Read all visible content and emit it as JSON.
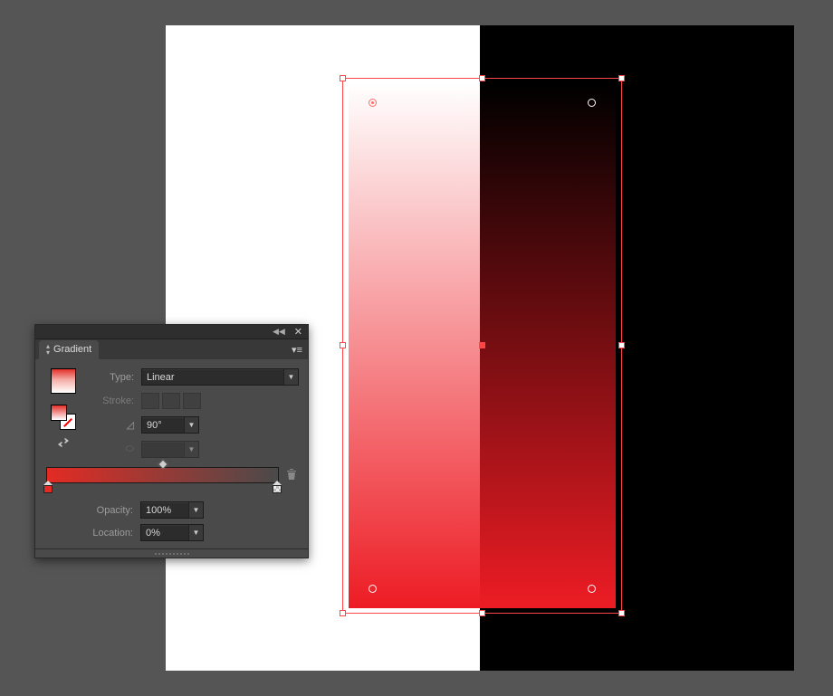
{
  "panel": {
    "title": "Gradient",
    "type_label": "Type:",
    "type_value": "Linear",
    "stroke_label": "Stroke:",
    "angle_value": "90°",
    "opacity_label": "Opacity:",
    "opacity_value": "100%",
    "location_label": "Location:",
    "location_value": "0%"
  },
  "gradient": {
    "start_color": "#ED1C24",
    "end_opacity": 0,
    "angle_deg": 90
  }
}
